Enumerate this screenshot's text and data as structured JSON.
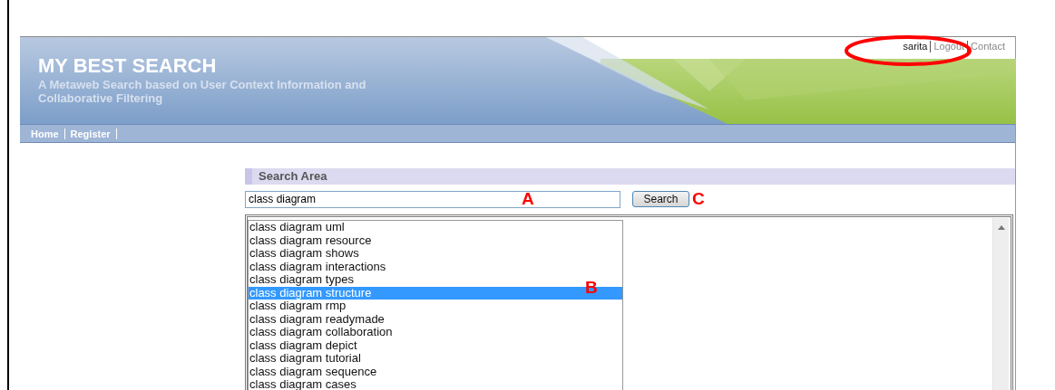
{
  "header": {
    "title": "MY BEST SEARCH",
    "subtitle": "A Metaweb Search based on User Context Information and Collaborative Filtering",
    "user": "sarita",
    "links": [
      "Logout",
      "Contact"
    ]
  },
  "nav": [
    "Home",
    "Register"
  ],
  "search": {
    "section_title": "Search Area",
    "value": "class diagram",
    "button": "Search"
  },
  "suggestions": [
    {
      "text": "class diagram uml",
      "selected": false
    },
    {
      "text": "class diagram resource",
      "selected": false
    },
    {
      "text": "class diagram shows",
      "selected": false
    },
    {
      "text": "class diagram interactions",
      "selected": false
    },
    {
      "text": "class diagram types",
      "selected": false
    },
    {
      "text": "class diagram structure",
      "selected": true
    },
    {
      "text": "class diagram rmp",
      "selected": false
    },
    {
      "text": "class diagram readymade",
      "selected": false
    },
    {
      "text": "class diagram collaboration",
      "selected": false
    },
    {
      "text": "class diagram depict",
      "selected": false
    },
    {
      "text": "class diagram tutorial",
      "selected": false
    },
    {
      "text": "class diagram sequence",
      "selected": false
    },
    {
      "text": "class diagram cases",
      "selected": false
    }
  ],
  "annotations": [
    {
      "label": "A",
      "kind": "field"
    },
    {
      "label": "B",
      "kind": "list"
    },
    {
      "label": "C",
      "kind": "button"
    }
  ]
}
